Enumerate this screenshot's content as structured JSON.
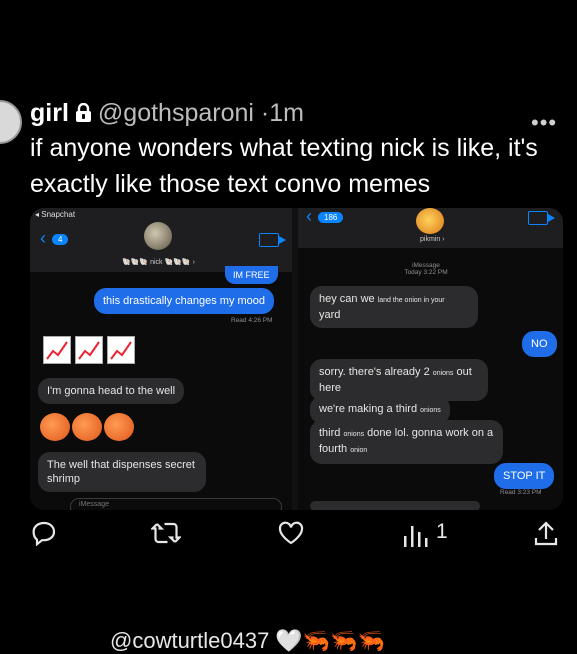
{
  "tweet": {
    "display_name": "girl",
    "handle": "@gothsparoni",
    "separator": "·",
    "time": "1m",
    "more_label": "•••",
    "text": "if anyone wonders what texting nick is like, it's exactly like those text convo memes"
  },
  "left_chat": {
    "status_app": "◂ Snapchat",
    "back_count": "4",
    "contact_name": "🐚🐚🐚 nick 🐚🐚🐚 ›",
    "partial_top": "IM FREE",
    "messages": [
      {
        "from": "me",
        "text": "this drastically changes my mood"
      },
      {
        "from": "them",
        "text": "I'm gonna head to the well"
      },
      {
        "from": "them",
        "text": "The well that dispenses secret shrimp"
      }
    ],
    "read_receipt": "Read 4:26 PM",
    "input_placeholder": "iMessage"
  },
  "right_chat": {
    "back_count": "186",
    "contact_name": "pikmin ›",
    "service": "iMessage",
    "date": "Today 3:22 PM",
    "messages": [
      {
        "from": "them",
        "text": "hey can we ",
        "small": "land the onion in your",
        "tail": " yard"
      },
      {
        "from": "me",
        "text": "NO"
      },
      {
        "from": "them",
        "text": "sorry. there's already 2",
        "small": "onions",
        "tail": " out here"
      },
      {
        "from": "them",
        "text": "we're making a third ",
        "small": "onions",
        "tail": ""
      },
      {
        "from": "them",
        "text": "third ",
        "small": "onions",
        "tail": " done lol. gonna work on a fourth ",
        "small2": "onion"
      },
      {
        "from": "me",
        "text": "STOP IT"
      }
    ],
    "read_receipt": "Read 3:23 PM"
  },
  "actions": {
    "views": "1",
    "icons": [
      "reply-icon",
      "retweet-icon",
      "like-icon",
      "views-icon",
      "share-icon"
    ]
  },
  "next_tweet_fragment": "@cowturtle0437 🤍🦐🦐🦐",
  "colors": {
    "accent_blue": "#1f6de8",
    "gray_bubble": "#2c2c2e",
    "background": "#000000"
  }
}
